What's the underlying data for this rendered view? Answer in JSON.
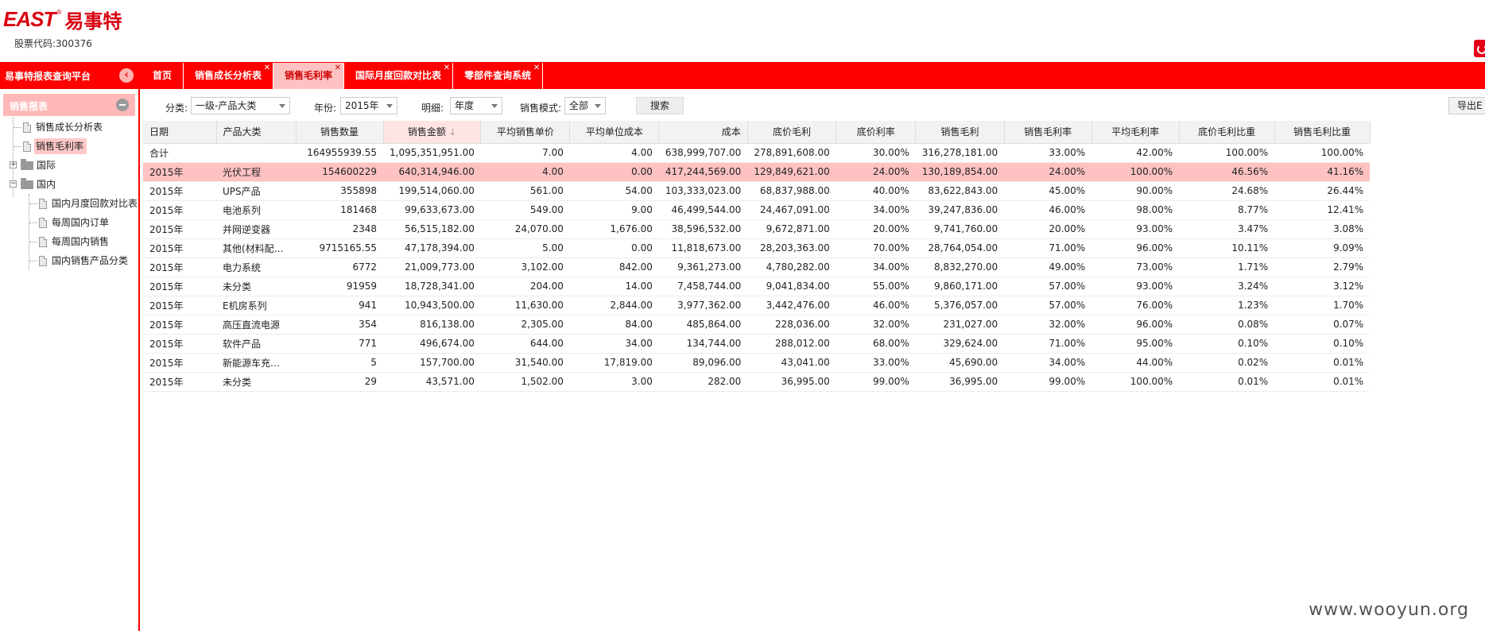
{
  "header": {
    "logo_text": "EAST",
    "logo_reg": "®",
    "logo_cn": "易事特",
    "stock_code": "股票代码:300376"
  },
  "platform_title": "易事特报表查询平台",
  "tabs": [
    {
      "label": "首页",
      "closable": false
    },
    {
      "label": "销售成长分析表",
      "closable": true
    },
    {
      "label": "销售毛利率",
      "closable": true,
      "active": true
    },
    {
      "label": "国际月度回款对比表",
      "closable": true
    },
    {
      "label": "零部件查询系统",
      "closable": true
    }
  ],
  "sidebar": {
    "section_label": "销售报表",
    "items": [
      {
        "label": "销售成长分析表"
      },
      {
        "label": "销售毛利率",
        "selected": true
      },
      {
        "label": "国际"
      },
      {
        "label": "国内"
      },
      {
        "label": "国内月度回款对比表"
      },
      {
        "label": "每周国内订单"
      },
      {
        "label": "每周国内销售"
      },
      {
        "label": "国内销售产品分类"
      }
    ]
  },
  "filters": {
    "category_label": "分类:",
    "category_value": "一级-产品大类",
    "year_label": "年份:",
    "year_value": "2015年",
    "detail_label": "明细:",
    "detail_value": "年度",
    "mode_label": "销售模式:",
    "mode_value": "全部",
    "search_label": "搜索",
    "export_label": "导出E"
  },
  "table": {
    "columns": [
      "日期",
      "产品大类",
      "销售数量",
      "销售金额",
      "平均销售单价",
      "平均单位成本",
      "成本",
      "底价毛利",
      "底价利率",
      "销售毛利",
      "销售毛利率",
      "平均毛利率",
      "底价毛利比重",
      "销售毛利比重"
    ],
    "sort_arrow": "↓",
    "rows": [
      [
        "合计",
        "",
        "164955939.55",
        "1,095,351,951.00",
        "7.00",
        "4.00",
        "638,999,707.00",
        "278,891,608.00",
        "30.00%",
        "316,278,181.00",
        "33.00%",
        "42.00%",
        "100.00%",
        "100.00%"
      ],
      [
        "2015年",
        "光伏工程",
        "154600229",
        "640,314,946.00",
        "4.00",
        "0.00",
        "417,244,569.00",
        "129,849,621.00",
        "24.00%",
        "130,189,854.00",
        "24.00%",
        "100.00%",
        "46.56%",
        "41.16%"
      ],
      [
        "2015年",
        "UPS产品",
        "355898",
        "199,514,060.00",
        "561.00",
        "54.00",
        "103,333,023.00",
        "68,837,988.00",
        "40.00%",
        "83,622,843.00",
        "45.00%",
        "90.00%",
        "24.68%",
        "26.44%"
      ],
      [
        "2015年",
        "电池系列",
        "181468",
        "99,633,673.00",
        "549.00",
        "9.00",
        "46,499,544.00",
        "24,467,091.00",
        "34.00%",
        "39,247,836.00",
        "46.00%",
        "98.00%",
        "8.77%",
        "12.41%"
      ],
      [
        "2015年",
        "并网逆变器",
        "2348",
        "56,515,182.00",
        "24,070.00",
        "1,676.00",
        "38,596,532.00",
        "9,672,871.00",
        "20.00%",
        "9,741,760.00",
        "20.00%",
        "93.00%",
        "3.47%",
        "3.08%"
      ],
      [
        "2015年",
        "其他(材料配…",
        "9715165.55",
        "47,178,394.00",
        "5.00",
        "0.00",
        "11,818,673.00",
        "28,203,363.00",
        "70.00%",
        "28,764,054.00",
        "71.00%",
        "96.00%",
        "10.11%",
        "9.09%"
      ],
      [
        "2015年",
        "电力系统",
        "6772",
        "21,009,773.00",
        "3,102.00",
        "842.00",
        "9,361,273.00",
        "4,780,282.00",
        "34.00%",
        "8,832,270.00",
        "49.00%",
        "73.00%",
        "1.71%",
        "2.79%"
      ],
      [
        "2015年",
        "未分类",
        "91959",
        "18,728,341.00",
        "204.00",
        "14.00",
        "7,458,744.00",
        "9,041,834.00",
        "55.00%",
        "9,860,171.00",
        "57.00%",
        "93.00%",
        "3.24%",
        "3.12%"
      ],
      [
        "2015年",
        "E机房系列",
        "941",
        "10,943,500.00",
        "11,630.00",
        "2,844.00",
        "3,977,362.00",
        "3,442,476.00",
        "46.00%",
        "5,376,057.00",
        "57.00%",
        "76.00%",
        "1.23%",
        "1.70%"
      ],
      [
        "2015年",
        "高压直流电源",
        "354",
        "816,138.00",
        "2,305.00",
        "84.00",
        "485,864.00",
        "228,036.00",
        "32.00%",
        "231,027.00",
        "32.00%",
        "96.00%",
        "0.08%",
        "0.07%"
      ],
      [
        "2015年",
        "软件产品",
        "771",
        "496,674.00",
        "644.00",
        "34.00",
        "134,744.00",
        "288,012.00",
        "68.00%",
        "329,624.00",
        "71.00%",
        "95.00%",
        "0.10%",
        "0.10%"
      ],
      [
        "2015年",
        "新能源车充…",
        "5",
        "157,700.00",
        "31,540.00",
        "17,819.00",
        "89,096.00",
        "43,041.00",
        "33.00%",
        "45,690.00",
        "34.00%",
        "44.00%",
        "0.02%",
        "0.01%"
      ],
      [
        "2015年",
        "未分类",
        "29",
        "43,571.00",
        "1,502.00",
        "3.00",
        "282.00",
        "36,995.00",
        "99.00%",
        "36,995.00",
        "99.00%",
        "100.00%",
        "0.01%",
        "0.01%"
      ]
    ]
  },
  "watermark": "www.wooyun.org",
  "colors": {
    "brand_red": "#ff0000",
    "highlight_row": "#ffc2c2",
    "sidebar_header": "#ffb8b8"
  }
}
